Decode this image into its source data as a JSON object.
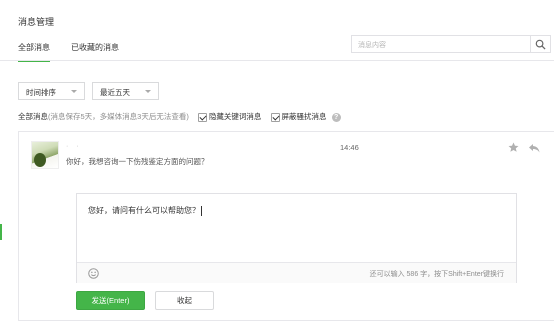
{
  "header": {
    "title": "消息管理"
  },
  "tabs": [
    {
      "label": "全部消息",
      "active": true
    },
    {
      "label": "已收藏的消息",
      "active": false
    }
  ],
  "search": {
    "placeholder": "消息内容",
    "icon": "search-icon"
  },
  "filters": {
    "sort": {
      "selected": "时间排序"
    },
    "range": {
      "selected": "最近五天"
    }
  },
  "summary": {
    "label": "全部消息",
    "note": "(消息保存5天，多媒体消息3天后无法查看)",
    "hide_keyword": {
      "label": "隐藏关键词消息",
      "checked": true
    },
    "block_spam": {
      "label": "屏蔽骚扰消息",
      "checked": true
    },
    "help_icon": "help-icon"
  },
  "message": {
    "nickname": "· ·",
    "text": "你好，我想咨询一下伤残鉴定方面的问题？",
    "time": "14:46",
    "star_icon": "star-icon",
    "reply_icon": "reply-icon"
  },
  "reply": {
    "value": "您好，请问有什么可以帮助您？",
    "emoji_icon": "emoji-icon",
    "counter": "还可以输入 586 字，按下Shift+Enter键换行"
  },
  "buttons": {
    "send": "发送(Enter)",
    "collapse": "收起"
  },
  "colors": {
    "accent": "#44b549",
    "border": "#e7e7eb"
  }
}
